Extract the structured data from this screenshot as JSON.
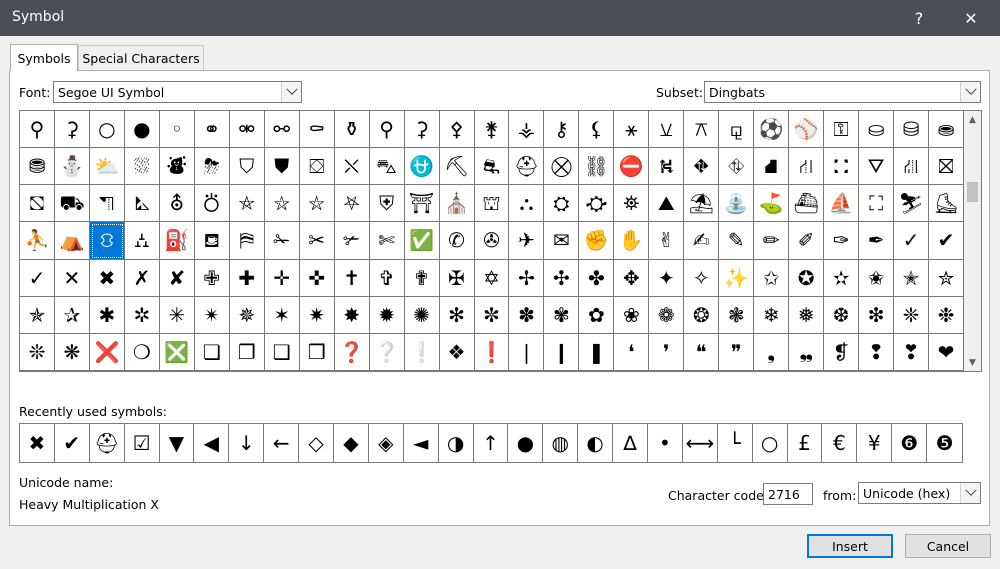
{
  "window": {
    "title": "Symbol",
    "help_label": "?",
    "close_label": "✕"
  },
  "tabs": [
    {
      "label": "Symbols",
      "active": true
    },
    {
      "label": "Special Characters",
      "active": false
    }
  ],
  "font": {
    "label": "Font:",
    "value": "Segoe UI Symbol"
  },
  "subset": {
    "label": "Subset:",
    "value": "Dingbats"
  },
  "symbol_grid": {
    "columns": 27,
    "selected_row": 3,
    "selected_col": 2,
    "rows": [
      [
        "⚲",
        "⚳",
        "○",
        "●",
        "◦",
        "⚭",
        "⚮",
        "⚯",
        "⚰",
        "⚱",
        "⚲",
        "⚳",
        "⚴",
        "⚵",
        "⚶",
        "⚷",
        "⚸",
        "⚹",
        "⚺",
        "⚻",
        "⚼",
        "⚽",
        "⚾",
        "⚿",
        "⛀",
        "⛁",
        "⛂"
      ],
      [
        "⛃",
        "⛄",
        "⛅",
        "⛆",
        "⛇",
        "⛈",
        "⛉",
        "⛊",
        "⛋",
        "⛌",
        "⛍",
        "⛎",
        "⛏",
        "⛐",
        "⛑",
        "⛒",
        "⛓",
        "⛔",
        "⛕",
        "⛖",
        "⛗",
        "⛘",
        "⛙",
        "⛚",
        "⛛",
        "⛜",
        "⛝"
      ],
      [
        "⛞",
        "⛟",
        "⛠",
        "⛡",
        "⛢",
        "⛣",
        "⛤",
        "⛥",
        "⛦",
        "⛧",
        "⛨",
        "⛩",
        "⛪",
        "⛫",
        "⛬",
        "⛭",
        "⛮",
        "⛯",
        "⛰",
        "⛱",
        "⛲",
        "⛳",
        "⛴",
        "⛵",
        "⛶",
        "⛷",
        "⛸"
      ],
      [
        "⛹",
        "⛺",
        "⛻",
        "⛼",
        "⛽",
        "⛾",
        "⛿",
        "✁",
        "✂",
        "✃",
        "✄",
        "✅",
        "✆",
        "✇",
        "✈",
        "✉",
        "✊",
        "✋",
        "✌",
        "✍",
        "✎",
        "✏",
        "✐",
        "✑",
        "✒",
        "✓",
        "✔"
      ],
      [
        "✓",
        "✕",
        "✖",
        "✗",
        "✘",
        "✙",
        "✚",
        "✛",
        "✜",
        "✝",
        "✞",
        "✟",
        "✠",
        "✡",
        "✢",
        "✣",
        "✤",
        "✥",
        "✦",
        "✧",
        "✨",
        "✩",
        "✪",
        "✫",
        "✬",
        "✭",
        "✮"
      ],
      [
        "✯",
        "✰",
        "✱",
        "✲",
        "✳",
        "✴",
        "✵",
        "✶",
        "✷",
        "✸",
        "✹",
        "✺",
        "✻",
        "✼",
        "✽",
        "✾",
        "✿",
        "❀",
        "❁",
        "❂",
        "❃",
        "❄",
        "❅",
        "❆",
        "❇",
        "❈",
        "❉"
      ],
      [
        "❊",
        "❋",
        "❌",
        "❍",
        "❎",
        "❏",
        "❐",
        "❑",
        "❒",
        "❓",
        "❔",
        "❕",
        "❖",
        "❗",
        "❘",
        "❙",
        "❚",
        "❛",
        "❜",
        "❝",
        "❞",
        "❟",
        "❠",
        "❡",
        "❢",
        "❣",
        "❤"
      ]
    ]
  },
  "recent": {
    "label": "Recently used symbols:",
    "symbols": [
      "✖",
      "✔",
      "⛑",
      "☑",
      "▼",
      "◀",
      "↓",
      "←",
      "◇",
      "◆",
      "◈",
      "◄",
      "◑",
      "↑",
      "●",
      "◍",
      "◐",
      "∆",
      "•",
      "⟷",
      "└",
      "○",
      "£",
      "€",
      "¥",
      "❻",
      "❺"
    ]
  },
  "unicode_name": {
    "label": "Unicode name:",
    "value": "Heavy Multiplication X"
  },
  "char_code": {
    "label": "Character code:",
    "value": "2716"
  },
  "from": {
    "label": "from:",
    "value": "Unicode (hex)"
  },
  "buttons": {
    "insert": "Insert",
    "cancel": "Cancel"
  }
}
